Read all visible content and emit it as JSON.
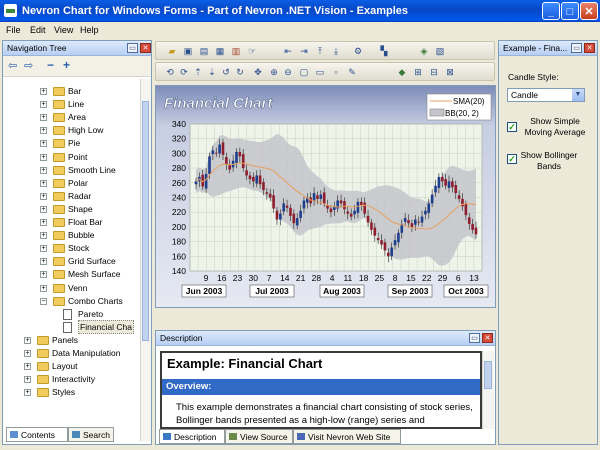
{
  "window": {
    "title": "Nevron Chart for Windows Forms - Part of Nevron .NET Vision - Examples"
  },
  "menu": [
    "File",
    "Edit",
    "View",
    "Help"
  ],
  "nav": {
    "title": "Navigation Tree",
    "items": [
      {
        "label": "Bar",
        "level": 2,
        "kind": "folder",
        "expand": "+"
      },
      {
        "label": "Line",
        "level": 2,
        "kind": "folder",
        "expand": "+"
      },
      {
        "label": "Area",
        "level": 2,
        "kind": "folder",
        "expand": "+"
      },
      {
        "label": "High Low",
        "level": 2,
        "kind": "folder",
        "expand": "+"
      },
      {
        "label": "Pie",
        "level": 2,
        "kind": "folder",
        "expand": "+"
      },
      {
        "label": "Point",
        "level": 2,
        "kind": "folder",
        "expand": "+"
      },
      {
        "label": "Smooth Line",
        "level": 2,
        "kind": "folder",
        "expand": "+"
      },
      {
        "label": "Polar",
        "level": 2,
        "kind": "folder",
        "expand": "+"
      },
      {
        "label": "Radar",
        "level": 2,
        "kind": "folder",
        "expand": "+"
      },
      {
        "label": "Shape",
        "level": 2,
        "kind": "folder",
        "expand": "+"
      },
      {
        "label": "Float Bar",
        "level": 2,
        "kind": "folder",
        "expand": "+"
      },
      {
        "label": "Bubble",
        "level": 2,
        "kind": "folder",
        "expand": "+"
      },
      {
        "label": "Stock",
        "level": 2,
        "kind": "folder",
        "expand": "+"
      },
      {
        "label": "Grid Surface",
        "level": 2,
        "kind": "folder",
        "expand": "+"
      },
      {
        "label": "Mesh Surface",
        "level": 2,
        "kind": "folder",
        "expand": "+"
      },
      {
        "label": "Venn",
        "level": 2,
        "kind": "folder",
        "expand": "+"
      },
      {
        "label": "Combo Charts",
        "level": 2,
        "kind": "folder",
        "expand": "−"
      },
      {
        "label": "Pareto",
        "level": 3,
        "kind": "doc",
        "expand": ""
      },
      {
        "label": "Financial Cha",
        "level": 3,
        "kind": "doc",
        "expand": "",
        "selected": true
      },
      {
        "label": "Panels",
        "level": 1,
        "kind": "folder",
        "expand": "+"
      },
      {
        "label": "Data Manipulation",
        "level": 1,
        "kind": "folder",
        "expand": "+"
      },
      {
        "label": "Layout",
        "level": 1,
        "kind": "folder",
        "expand": "+"
      },
      {
        "label": "Interactivity",
        "level": 1,
        "kind": "folder",
        "expand": "+"
      },
      {
        "label": "Styles",
        "level": 1,
        "kind": "folder",
        "expand": "+"
      }
    ],
    "tabs": [
      "Contents",
      "Search"
    ]
  },
  "chart_data": {
    "type": "candlestick",
    "title": "Financial Chart",
    "legend": [
      "SMA(20)",
      "BB(20, 2)"
    ],
    "legend_position": "top-right",
    "ylim": [
      140,
      340
    ],
    "yticks": [
      140,
      160,
      180,
      200,
      220,
      240,
      260,
      280,
      300,
      320,
      340
    ],
    "xtick_days": [
      "9",
      "16",
      "23",
      "30",
      "7",
      "14",
      "21",
      "28",
      "4",
      "11",
      "18",
      "25",
      "8",
      "15",
      "22",
      "29",
      "6",
      "13"
    ],
    "months": [
      "Jun 2003",
      "Jul 2003",
      "Aug 2003",
      "Sep 2003",
      "Oct 2003"
    ],
    "close": [
      262,
      268,
      255,
      272,
      296,
      304,
      300,
      312,
      298,
      285,
      278,
      290,
      302,
      296,
      280,
      270,
      265,
      262,
      270,
      258,
      250,
      245,
      240,
      225,
      210,
      218,
      232,
      226,
      215,
      205,
      212,
      222,
      236,
      240,
      232,
      246,
      238,
      244,
      232,
      225,
      220,
      228,
      236,
      232,
      224,
      218,
      214,
      222,
      234,
      230,
      218,
      206,
      196,
      188,
      182,
      176,
      168,
      160,
      172,
      182,
      192,
      204,
      212,
      205,
      200,
      210,
      206,
      214,
      222,
      232,
      244,
      256,
      268,
      262,
      256,
      262,
      254,
      246,
      238,
      228,
      216,
      204,
      196,
      190
    ],
    "grid": "on",
    "sma_color": "#E8A060",
    "band_color": "#C4C4CA",
    "up_color": "#1E3E8E",
    "down_color": "#8E1E2E"
  },
  "description": {
    "panel_title": "Description",
    "heading": "Example: Financial Chart",
    "overview": "Overview:",
    "text": "This example demonstrates a financial chart consisting of stock series, Bollinger bands presented as a high-low (range) series and",
    "tabs": [
      "Description",
      "View Source",
      "Visit Nevron Web Site"
    ]
  },
  "right": {
    "title": "Example - Fina...",
    "candle_style_label": "Candle Style:",
    "candle_style_value": "Candle",
    "sma_label": "Show Simple Moving Average",
    "bb_label": "Show Bollinger Bands"
  }
}
